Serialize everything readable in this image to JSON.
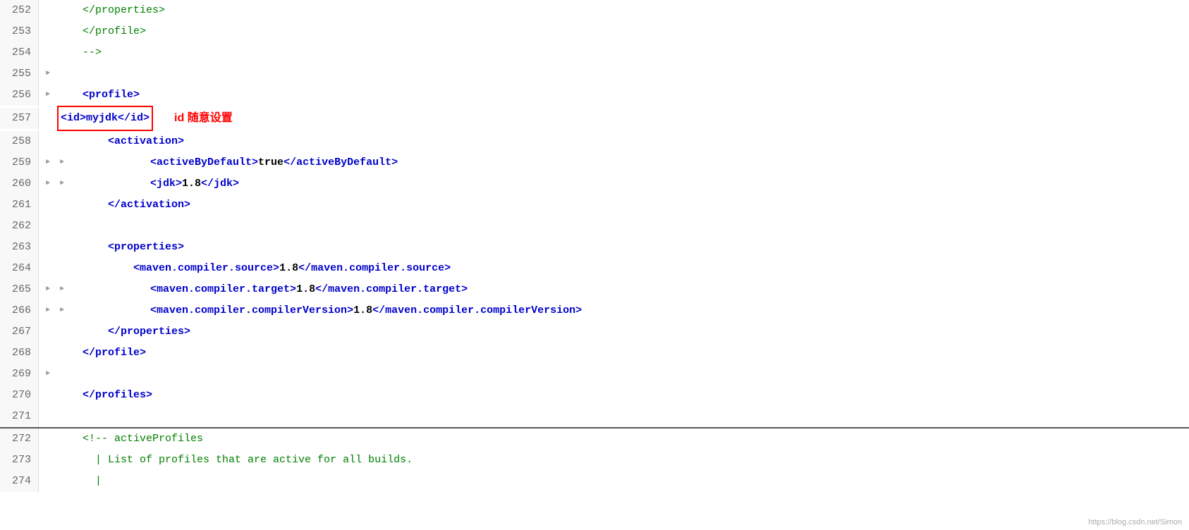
{
  "lines": [
    {
      "num": 252,
      "indent": 2,
      "hasArrow": false,
      "arrowDir": "",
      "content": "xml_close_properties",
      "display": "    </properties>"
    },
    {
      "num": 253,
      "indent": 2,
      "hasArrow": false,
      "arrowDir": "",
      "content": "xml_close_profile",
      "display": "    </profile>"
    },
    {
      "num": 254,
      "indent": 2,
      "hasArrow": false,
      "arrowDir": "",
      "content": "xml_comment_close",
      "display": "    -->"
    },
    {
      "num": 255,
      "indent": 0,
      "hasArrow": true,
      "arrowDir": "right",
      "content": "empty",
      "display": ""
    },
    {
      "num": 256,
      "indent": 1,
      "hasArrow": true,
      "arrowDir": "right",
      "content": "profile_open",
      "display": "    <profile>"
    },
    {
      "num": 257,
      "indent": 2,
      "hasArrow": false,
      "arrowDir": "",
      "content": "id_myjdk",
      "display": "        <id>myjdk</id>",
      "annotation": "id 随意设置",
      "hasBox": true
    },
    {
      "num": 258,
      "indent": 2,
      "hasArrow": false,
      "arrowDir": "",
      "content": "activation_open",
      "display": "        <activation>"
    },
    {
      "num": 259,
      "indent": 3,
      "hasArrow": true,
      "arrowDir": "right",
      "content": "activeByDefault",
      "display": "            <activeByDefault>true</activeByDefault>"
    },
    {
      "num": 260,
      "indent": 3,
      "hasArrow": true,
      "arrowDir": "right",
      "content": "jdk18",
      "display": "            <jdk>1.8</jdk>"
    },
    {
      "num": 261,
      "indent": 2,
      "hasArrow": false,
      "arrowDir": "",
      "content": "activation_close",
      "display": "        </activation>"
    },
    {
      "num": 262,
      "indent": 0,
      "hasArrow": false,
      "arrowDir": "",
      "content": "empty2",
      "display": ""
    },
    {
      "num": 263,
      "indent": 2,
      "hasArrow": false,
      "arrowDir": "",
      "content": "properties_open",
      "display": "        <properties>"
    },
    {
      "num": 264,
      "indent": 3,
      "hasArrow": false,
      "arrowDir": "",
      "content": "compiler_source",
      "display": "            <maven.compiler.source>1.8</maven.compiler.source>"
    },
    {
      "num": 265,
      "indent": 3,
      "hasArrow": true,
      "arrowDir": "right",
      "content": "compiler_target",
      "display": "            <maven.compiler.target>1.8</maven.compiler.target>"
    },
    {
      "num": 266,
      "indent": 3,
      "hasArrow": true,
      "arrowDir": "right",
      "content": "compiler_version",
      "display": "            <maven.compiler.compilerVersion>1.8</maven.compiler.compilerVersion>"
    },
    {
      "num": 267,
      "indent": 2,
      "hasArrow": false,
      "arrowDir": "",
      "content": "properties_close",
      "display": "        </properties>"
    },
    {
      "num": 268,
      "indent": 2,
      "hasArrow": false,
      "arrowDir": "",
      "content": "profile_close",
      "display": "    </profile>"
    },
    {
      "num": 269,
      "indent": 0,
      "hasArrow": true,
      "arrowDir": "right",
      "content": "empty3",
      "display": ""
    },
    {
      "num": 270,
      "indent": 1,
      "hasArrow": false,
      "arrowDir": "",
      "content": "profiles_close",
      "display": "    </profiles>"
    },
    {
      "num": 271,
      "indent": 0,
      "hasArrow": false,
      "arrowDir": "",
      "content": "empty4",
      "display": "",
      "isDivider": true
    },
    {
      "num": 272,
      "indent": 0,
      "hasArrow": false,
      "arrowDir": "",
      "content": "comment_activeProfiles",
      "display": "    <!-- activeProfiles"
    },
    {
      "num": 273,
      "indent": 0,
      "hasArrow": false,
      "arrowDir": "",
      "content": "comment_list",
      "display": "      | List of profiles that are active for all builds."
    },
    {
      "num": 274,
      "indent": 0,
      "hasArrow": false,
      "arrowDir": "",
      "content": "comment_pipe",
      "display": "      |"
    }
  ],
  "watermark": "https://blog.csdn.net/Simon",
  "annotation": "id 随意设置"
}
